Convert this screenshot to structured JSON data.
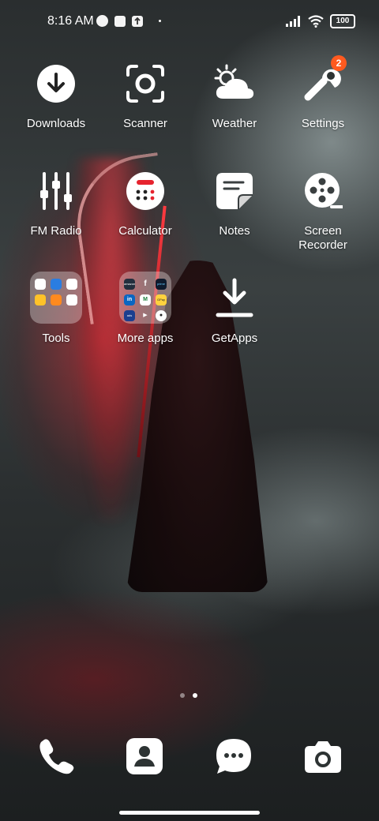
{
  "status_bar": {
    "time": "8:16 AM",
    "battery": "100",
    "icons": [
      "alarm-icon",
      "notification-square-icon",
      "upload-icon",
      "dot-icon",
      "signal-icon",
      "wifi-icon",
      "battery-icon"
    ]
  },
  "apps": {
    "row1": [
      {
        "label": "Downloads",
        "icon": "download-icon"
      },
      {
        "label": "Scanner",
        "icon": "scanner-icon"
      },
      {
        "label": "Weather",
        "icon": "weather-icon"
      },
      {
        "label": "Settings",
        "icon": "wrench-icon",
        "badge": "2"
      }
    ],
    "row2": [
      {
        "label": "FM Radio",
        "icon": "equalizer-icon"
      },
      {
        "label": "Calculator",
        "icon": "calculator-icon"
      },
      {
        "label": "Notes",
        "icon": "notes-icon"
      },
      {
        "label": "Screen Recorder",
        "icon": "film-reel-icon"
      }
    ],
    "row3": [
      {
        "label": "Tools",
        "icon": "folder-icon"
      },
      {
        "label": "More apps",
        "icon": "folder-icon"
      },
      {
        "label": "GetApps",
        "icon": "getapps-download-icon"
      }
    ]
  },
  "folder_more_apps": {
    "mini_labels": [
      "amazon",
      "f",
      "prime",
      "in",
      "M",
      "GPay",
      "ads",
      "▶",
      "●"
    ]
  },
  "dock": [
    {
      "icon": "phone-icon"
    },
    {
      "icon": "contacts-icon"
    },
    {
      "icon": "messages-icon"
    },
    {
      "icon": "camera-icon"
    }
  ],
  "page_indicator": {
    "total": 2,
    "active": 2
  }
}
